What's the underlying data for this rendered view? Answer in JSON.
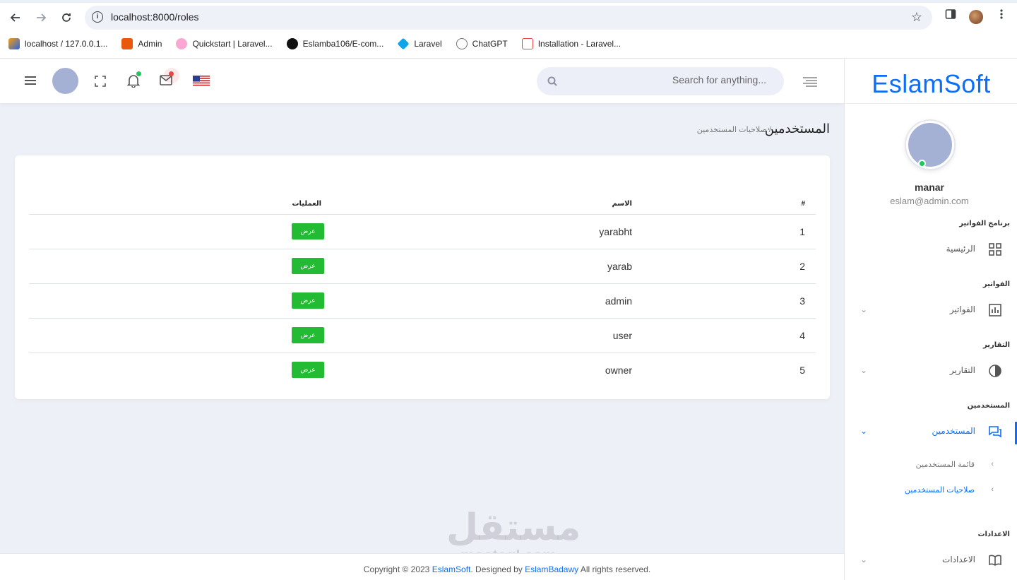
{
  "browser": {
    "url": "localhost:8000/roles",
    "bookmarks": [
      {
        "label": "localhost / 127.0.0.1...",
        "color": "#f59e0b"
      },
      {
        "label": "Admin",
        "color": "#ea580c"
      },
      {
        "label": "Quickstart | Laravel...",
        "color": "#db2777"
      },
      {
        "label": "Eslamba106/E-com...",
        "color": "#111111"
      },
      {
        "label": "Laravel",
        "color": "#0ea5e9"
      },
      {
        "label": "ChatGPT",
        "color": "#6b7280"
      },
      {
        "label": "Installation - Laravel...",
        "color": "#ef4444"
      }
    ]
  },
  "header": {
    "search_placeholder": "Search for anything..."
  },
  "sidebar": {
    "brand": "EslamSoft",
    "user_name": "manar",
    "user_email": "eslam@admin.com",
    "sections": {
      "invoices_program": "برنامج الفواتير",
      "invoices": "الفواتير",
      "reports": "التقارير",
      "users": "المستخدمين",
      "settings": "الاعدادات"
    },
    "items": {
      "home": "الرئيسية",
      "invoices": "الفواتير",
      "reports": "التقارير",
      "users": "المستخدمين",
      "settings": "الاعدادات"
    },
    "sub_items": {
      "users_list": "قائمة المستخدمين",
      "user_roles": "صلاحيات المستخدمين"
    }
  },
  "page": {
    "title": "المستخدمين",
    "breadcrumb": "/ صلاحيات المستخدمين"
  },
  "table": {
    "headers": {
      "num": "#",
      "name": "الاسم",
      "actions": "العمليات"
    },
    "action_label": "عرض",
    "rows": [
      {
        "num": "1",
        "name": "yarabht"
      },
      {
        "num": "2",
        "name": "yarab"
      },
      {
        "num": "3",
        "name": "admin"
      },
      {
        "num": "4",
        "name": "user"
      },
      {
        "num": "5",
        "name": "owner"
      }
    ]
  },
  "footer": {
    "prefix": "Copyright © 2023 ",
    "brand": "EslamSoft",
    "middle": ". Designed by ",
    "author": "EslamBadawy",
    "suffix": " All rights reserved."
  },
  "watermark": {
    "arabic": "مستقل",
    "latin": "mostaql.com"
  },
  "colors": {
    "accent": "#0d6efd",
    "success": "#22bb33",
    "online": "#22c55e",
    "alert": "#ef4444"
  }
}
